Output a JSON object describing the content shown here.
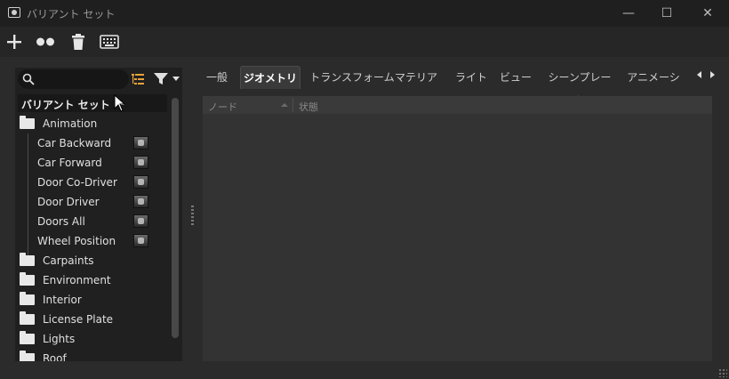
{
  "window": {
    "title": "バリアント セット",
    "controls": {
      "minimize": "—",
      "maximize": "☐",
      "close": "✕"
    }
  },
  "toolbar": {
    "buttons": [
      {
        "name": "add",
        "icon": "plus-icon"
      },
      {
        "name": "variant-dots",
        "icon": "dots-icon"
      },
      {
        "name": "delete",
        "icon": "trash-icon"
      },
      {
        "name": "keyboard",
        "icon": "keyboard-icon"
      }
    ]
  },
  "search": {
    "placeholder": "",
    "value": ""
  },
  "tree": {
    "header": "バリアント セット",
    "items": [
      {
        "label": "Animation",
        "type": "folder",
        "expanded": true
      },
      {
        "label": "Car Backward",
        "type": "variant"
      },
      {
        "label": "Car Forward",
        "type": "variant"
      },
      {
        "label": "Door Co-Driver",
        "type": "variant"
      },
      {
        "label": "Door Driver",
        "type": "variant"
      },
      {
        "label": "Doors All",
        "type": "variant"
      },
      {
        "label": "Wheel Position",
        "type": "variant"
      },
      {
        "label": "Carpaints",
        "type": "folder"
      },
      {
        "label": "Environment",
        "type": "folder"
      },
      {
        "label": "Interior",
        "type": "folder"
      },
      {
        "label": "License Plate",
        "type": "folder"
      },
      {
        "label": "Lights",
        "type": "folder"
      },
      {
        "label": "Roof",
        "type": "folder"
      }
    ]
  },
  "tabs": [
    {
      "label": "一般"
    },
    {
      "label": "ジオメトリ",
      "active": true
    },
    {
      "label": "トランスフォーム"
    },
    {
      "label": "マテリアル"
    },
    {
      "label": "ライト"
    },
    {
      "label": "ビュー"
    },
    {
      "label": "シーンプレート"
    },
    {
      "label": "アニメーション"
    }
  ],
  "table": {
    "columns": [
      "ノード",
      "状態"
    ],
    "rows": []
  },
  "colors": {
    "background": "#2b2b2b",
    "titlebar": "#1f1f1f",
    "panel": "#202020",
    "accent": "#e8a33a"
  }
}
